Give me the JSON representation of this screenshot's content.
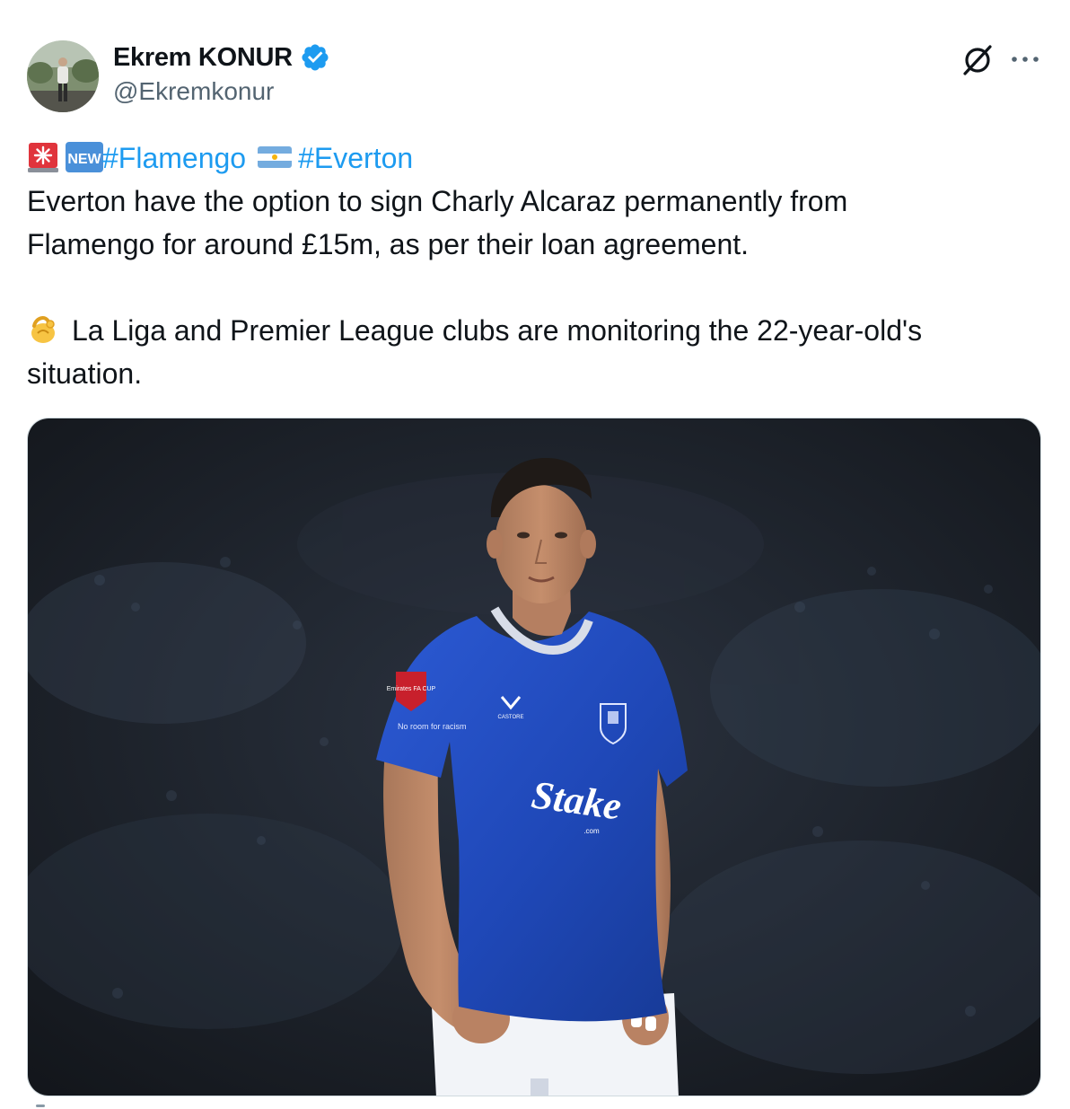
{
  "author": {
    "display_name": "Ekrem KONUR",
    "handle": "@Ekremkonur",
    "verified": true,
    "verified_color": "#1d9bf0"
  },
  "header_actions": {
    "grok_icon": "grok-icon",
    "more_icon": "more-dots-icon"
  },
  "tweet": {
    "line1": {
      "emoji_1": "rotating-light-emoji",
      "emoji_2": "new-button-emoji",
      "hashtag_1": "#Flamengo",
      "flag": "argentina-flag-emoji",
      "hashtag_2": "#Everton"
    },
    "line2": "Everton have the option to sign Charly Alcaraz permanently from",
    "line3": "Flamengo for around £15m, as per their loan agreement.",
    "line4_emoji": "pinching-hand-emoji",
    "line4": "La Liga and Premier League clubs are monitoring the 22-year-old's",
    "line5": "situation."
  },
  "media": {
    "shirt_sponsor": "Stake",
    "shirt_sponsor_sub": ".com",
    "kit_brand": "CASTORE",
    "sleeve_badge": "Emirates FA CUP",
    "sleeve_text": "No room for racism"
  },
  "colors": {
    "hashtag": "#1d9bf0",
    "text": "#0f1419",
    "secondary_text": "#536471",
    "shirt_blue": "#2350c8"
  }
}
